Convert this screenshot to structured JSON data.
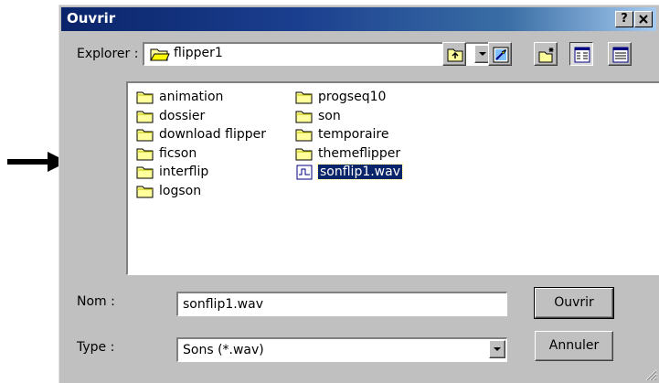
{
  "dialog": {
    "title": "Ouvrir",
    "help_button": "?",
    "close_button": "✕"
  },
  "lookin": {
    "label": "Explorer :",
    "label_mnemonic": "r",
    "value": "flipper1"
  },
  "toolbar": {
    "up_folder": "up-one-level-icon",
    "desktop": "desktop-icon",
    "new_folder": "new-folder-icon",
    "list_view": "list-view-icon",
    "details_view": "details-view-icon"
  },
  "files": {
    "col1": [
      "animation",
      "dossier",
      "download flipper",
      "ficson",
      "interflip",
      "logson"
    ],
    "col2": [
      "progseq10",
      "son",
      "temporaire",
      "themeflipper",
      "sonflip1.wav"
    ]
  },
  "filename": {
    "label": "Nom :",
    "value": "sonflip1.wav"
  },
  "filetype": {
    "label": "Type :",
    "value": "Sons (*.wav)"
  },
  "buttons": {
    "open": "Ouvrir",
    "cancel": "Annuler"
  },
  "colors": {
    "title_gradient_start": "#0a246a",
    "title_gradient_end": "#a6caf0",
    "face": "#c0c0c0",
    "selection": "#0a246a"
  }
}
